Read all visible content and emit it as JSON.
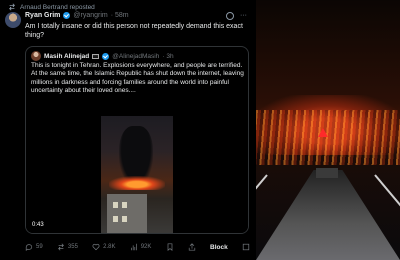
{
  "repost": {
    "text": "Arnaud Bertrand reposted"
  },
  "tweet": {
    "name": "Ryan Grim",
    "handle": "@ryangrim",
    "time": "· 58m",
    "text": "Am I totally insane or did this person not repeatedly demand this exact thing?"
  },
  "quote": {
    "name": "Masih Alinejad",
    "handle": "@AlinejadMasih",
    "time": "· 3h",
    "text_1": "This is tonight in Tehran. Explosions everywhere, and people are terrified.",
    "text_2": "At the same time, the Islamic Republic has shut down the internet, leaving millions in darkness and forcing families around the world into painful uncertainty about their loved ones....",
    "video_time": "0:43"
  },
  "actions": {
    "reply_count": "59",
    "repost_count": "355",
    "like_count": "2.8K",
    "view_count": "92K",
    "block_label": "Block"
  },
  "colors": {
    "accent": "#1d9bf0",
    "background": "#000000",
    "muted": "#71767b"
  }
}
